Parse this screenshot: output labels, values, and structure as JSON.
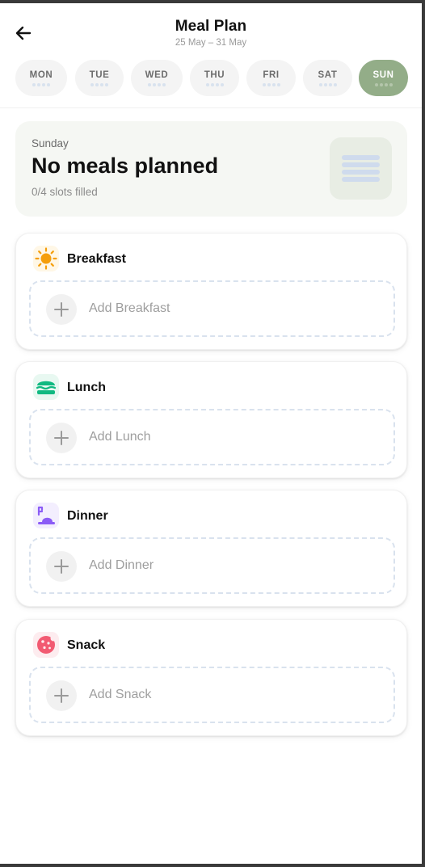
{
  "header": {
    "title": "Meal Plan",
    "subtitle": "25 May – 31 May",
    "back_icon": "arrow-left-icon"
  },
  "days": [
    {
      "label": "MON",
      "active": false
    },
    {
      "label": "TUE",
      "active": false
    },
    {
      "label": "WED",
      "active": false
    },
    {
      "label": "THU",
      "active": false
    },
    {
      "label": "FRI",
      "active": false
    },
    {
      "label": "SAT",
      "active": false
    },
    {
      "label": "SUN",
      "active": true
    }
  ],
  "summary": {
    "day_name": "Sunday",
    "status": "No meals planned",
    "slots_filled": "0/4 slots filled"
  },
  "meals": [
    {
      "name": "Breakfast",
      "add_label": "Add Breakfast",
      "icon": "sun-icon"
    },
    {
      "name": "Lunch",
      "add_label": "Add Lunch",
      "icon": "burger-icon"
    },
    {
      "name": "Dinner",
      "add_label": "Add Dinner",
      "icon": "dinner-icon"
    },
    {
      "name": "Snack",
      "add_label": "Add Snack",
      "icon": "cookie-icon"
    }
  ],
  "colors": {
    "accent": "#93ad88",
    "breakfast": "#f59e0b",
    "lunch": "#10b981",
    "dinner": "#8b5cf6",
    "snack": "#f25a72"
  }
}
